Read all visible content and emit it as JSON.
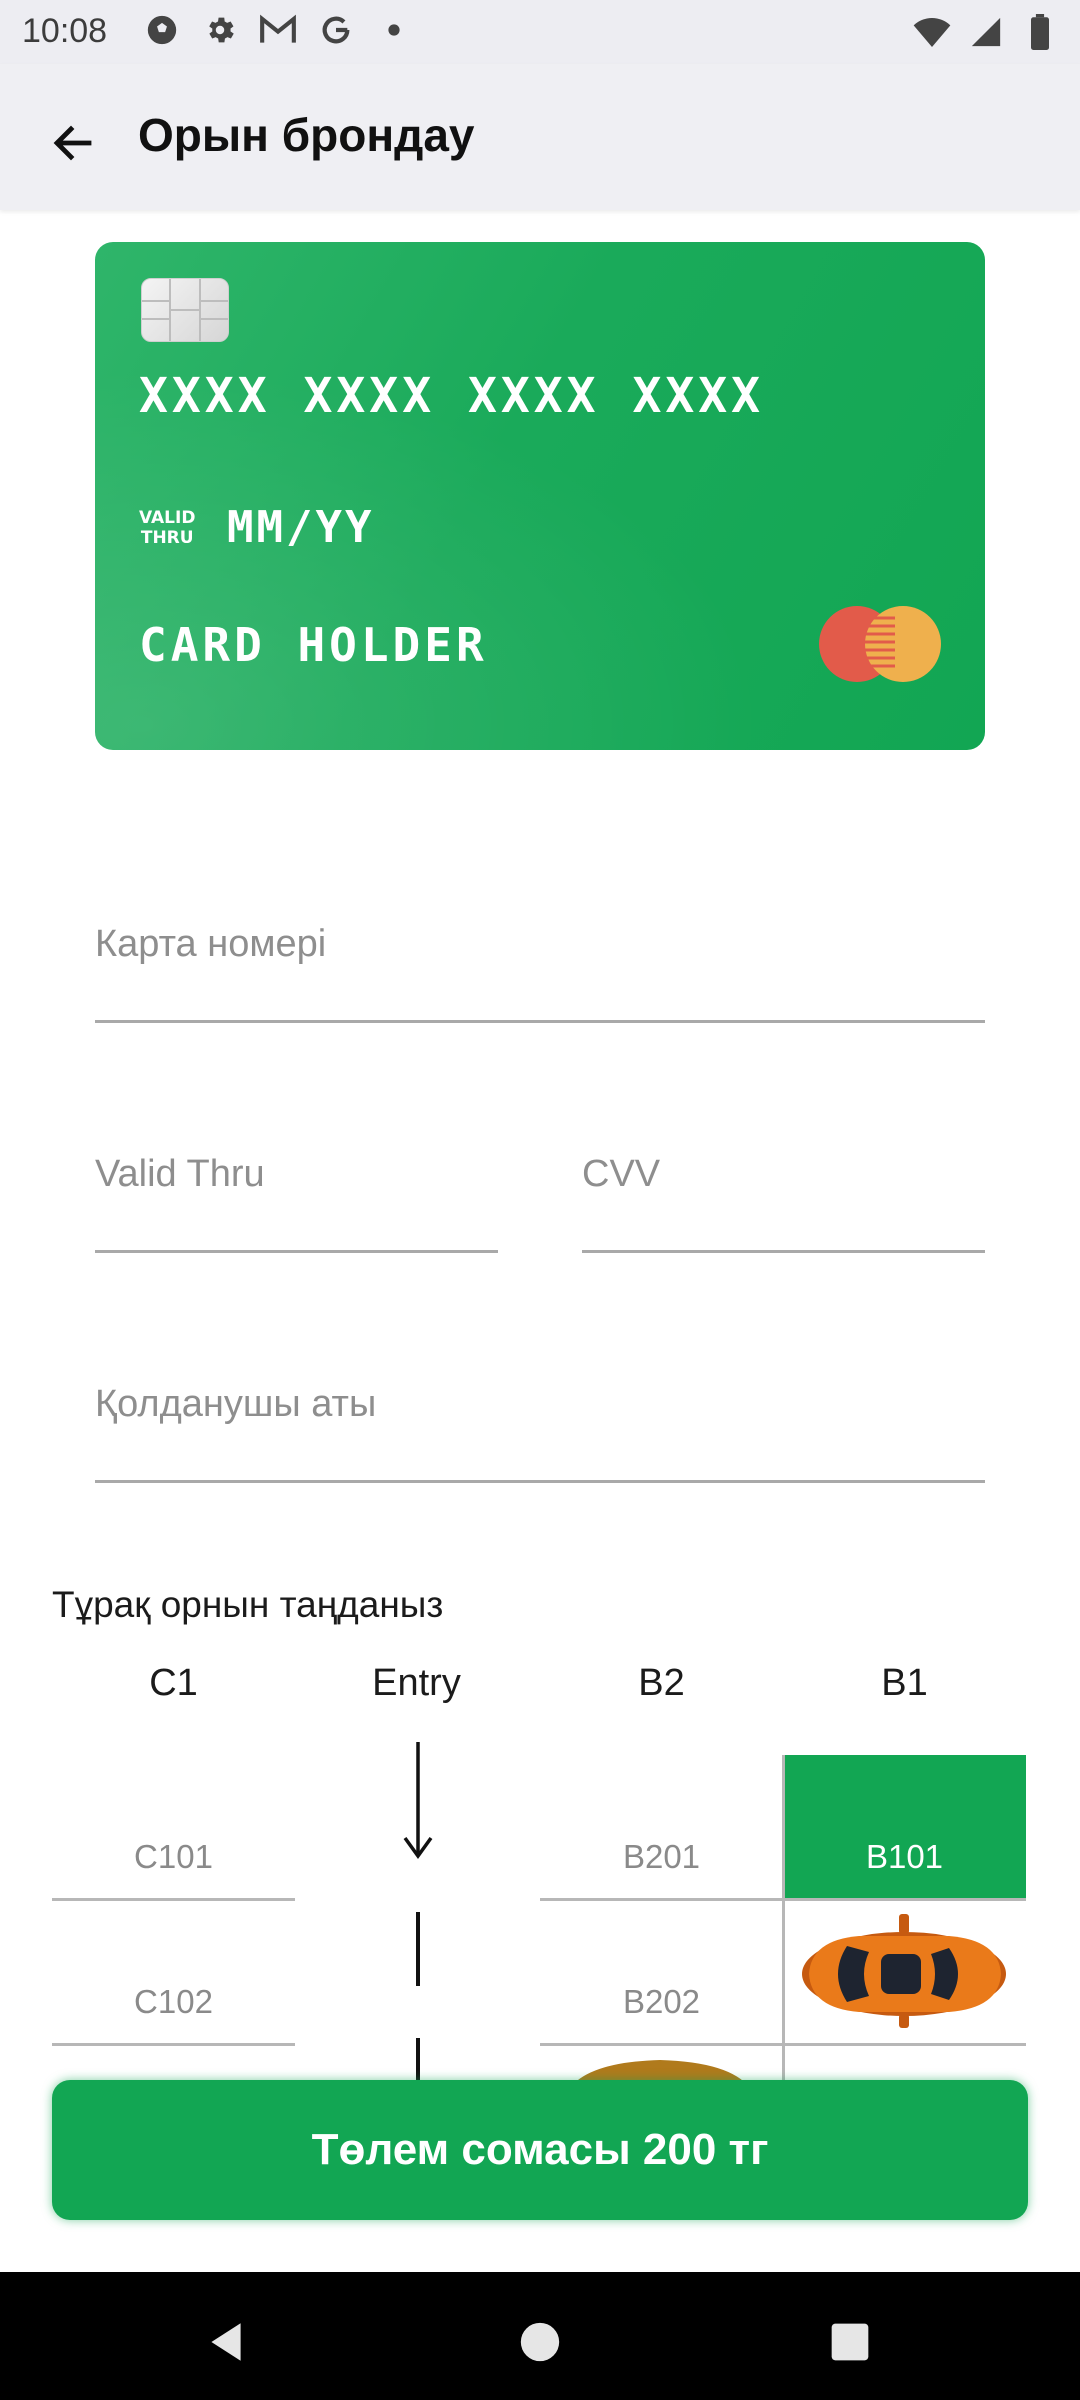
{
  "status_bar": {
    "time": "10:08",
    "left_icons": [
      "soccer-ball-icon",
      "gear-icon",
      "gmail-icon",
      "google-icon",
      "dot-icon"
    ],
    "right_icons": [
      "wifi-icon",
      "signal-icon",
      "battery-icon"
    ]
  },
  "app_bar": {
    "title": "Орын брондау",
    "back_icon": "arrow-left-icon"
  },
  "card_preview": {
    "number": "XXXX XXXX XXXX XXXX",
    "valid_label_line1": "VALID",
    "valid_label_line2": "THRU",
    "expiry": "MM/YY",
    "holder": "CARD HOLDER",
    "brand_icon": "mastercard-logo-icon",
    "color": "#12a653"
  },
  "form": {
    "card_number_placeholder": "Карта номері",
    "valid_thru_placeholder": "Valid Thru",
    "cvv_placeholder": "CVV",
    "username_placeholder": "Қолданушы аты"
  },
  "parking": {
    "section_title": "Тұрақ орнын таңданыз",
    "columns": [
      "C1",
      "Entry",
      "B2",
      "B1"
    ],
    "slots": {
      "c101": "C101",
      "c102": "C102",
      "b201": "B201",
      "b202": "B202",
      "b101": "B101"
    },
    "selected_slot": "B101",
    "occupied_icon": "orange-car-icon"
  },
  "pay_button": {
    "label": "Төлем сомасы 200 тг"
  },
  "nav_bar": {
    "icons": [
      "back-triangle-icon",
      "home-circle-icon",
      "recents-square-icon"
    ]
  },
  "accent_color": "#12a653"
}
